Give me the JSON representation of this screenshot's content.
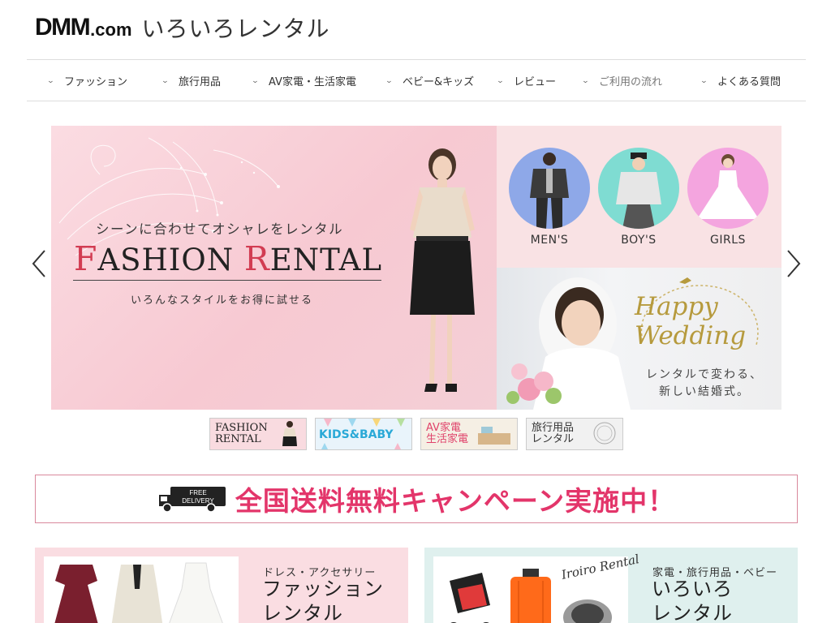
{
  "header": {
    "logo_main": "DMM",
    "logo_suffix": ".com",
    "site_name": "いろいろレンタル"
  },
  "nav": {
    "items": [
      {
        "label": "ファッション"
      },
      {
        "label": "旅行用品"
      },
      {
        "label": "AV家電・生活家電"
      },
      {
        "label": "ベビー&キッズ"
      },
      {
        "label": "レビュー"
      },
      {
        "label": "ご利用の流れ"
      },
      {
        "label": "よくある質問"
      }
    ],
    "chevron_icon": "chevron-down-icon"
  },
  "hero": {
    "fashion": {
      "subtitle": "シーンに合わせてオシャレをレンタル",
      "title_f": "F",
      "title_ashion": "ASHION ",
      "title_r": "R",
      "title_ental": "ENTAL",
      "tagline": "いろんなスタイルをお得に試せる"
    },
    "categories": [
      {
        "label": "MEN'S",
        "color": "#8ea8e8"
      },
      {
        "label": "BOY'S",
        "color": "#7fdcd2"
      },
      {
        "label": "GIRLS",
        "color": "#f4a5df"
      }
    ],
    "wedding": {
      "title_1": "Happy",
      "title_2": "Wedding",
      "sub_1": "レンタルで変わる、",
      "sub_2": "新しい結婚式。"
    },
    "prev_icon": "chevron-left-icon",
    "next_icon": "chevron-right-icon"
  },
  "thumbnails": [
    {
      "line1": "FASHION",
      "line2": "RENTAL"
    },
    {
      "line1": "KIDS&BABY"
    },
    {
      "line1": "AV家電",
      "line2": "生活家電"
    },
    {
      "line1": "旅行用品",
      "line2": "レンタル"
    }
  ],
  "shipping": {
    "badge_line1": "FREE",
    "badge_line2": "DELIVERY",
    "text": "全国送料無料キャンペーン実施中！"
  },
  "cards": {
    "fashion": {
      "kicker": "ドレス・アクセサリー",
      "title_1": "ファッション",
      "title_2": "レンタル"
    },
    "iroiro": {
      "script": "Iroiro Rental",
      "kicker": "家電・旅行用品・ベビー",
      "title_1": "いろいろ",
      "title_2": "レンタル"
    }
  },
  "colors": {
    "accent_pink": "#e3356a",
    "title_red": "#d23c52",
    "wedding_gold": "#b69a3d"
  }
}
